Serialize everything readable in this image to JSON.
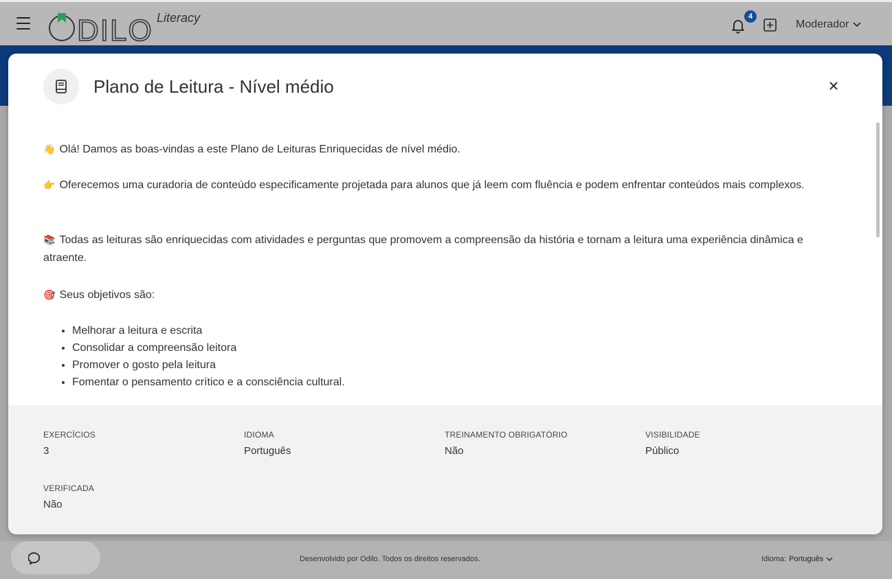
{
  "header": {
    "logo_text": "ODILO",
    "logo_sub": "Literacy",
    "notification_count": "4",
    "user_label": "Moderador"
  },
  "modal": {
    "title": "Plano de Leitura - Nível médio",
    "paragraphs": [
      "Olá! Damos as boas-vindas a este Plano de Leituras Enriquecidas de nível médio.",
      "Oferecemos uma curadoria de conteúdo especificamente projetada para alunos que já leem com fluência e podem enfrentar conteúdos mais complexos.",
      "Todas as leituras são enriquecidas com atividades e perguntas que promovem a compreensão da história e tornam a leitura uma experiência dinâmica e atraente.",
      "Seus objetivos são:"
    ],
    "emojis": [
      "👋",
      "👉",
      "📚",
      "🎯"
    ],
    "objectives": [
      "Melhorar a leitura e escrita",
      "Consolidar a compreensão leitora",
      "Promover o gosto pela leitura",
      "Fomentar o pensamento crítico e a consciência cultural."
    ],
    "meta": [
      {
        "label": "EXERCÍCIOS",
        "value": "3"
      },
      {
        "label": "IDIOMA",
        "value": "Português"
      },
      {
        "label": "TREINAMENTO OBRIGATÓRIO",
        "value": "Não"
      },
      {
        "label": "VISIBILIDADE",
        "value": "Público"
      },
      {
        "label": "VERIFICADA",
        "value": "Não"
      }
    ]
  },
  "footer": {
    "copyright": "Desenvolvido por Odilo. Todos os direitos reservados.",
    "language_label": "Idioma:",
    "language_value": "Português"
  },
  "colors": {
    "brand_blue": "#0c3a7a",
    "badge_blue": "#144e99",
    "logo_green": "#2e9e5b"
  }
}
